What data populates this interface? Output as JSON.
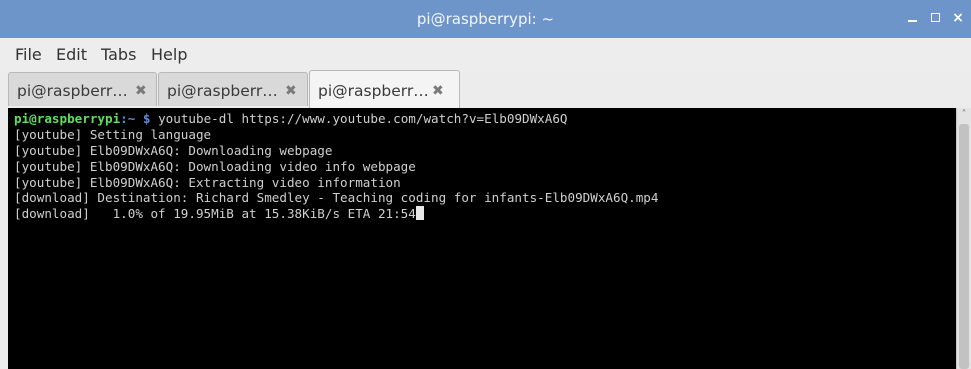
{
  "window": {
    "title": "pi@raspberrypi: ~",
    "controls": {
      "minimize": "minimize",
      "maximize": "maximize",
      "close": "×"
    }
  },
  "menu": [
    "File",
    "Edit",
    "Tabs",
    "Help"
  ],
  "tabs": [
    {
      "label": "pi@raspberr…",
      "close": "✖",
      "active": false
    },
    {
      "label": "pi@raspberr…",
      "close": "✖",
      "active": false
    },
    {
      "label": "pi@raspberr…",
      "close": "✖",
      "active": true
    }
  ],
  "terminal": {
    "prompt_user": "pi@raspberrypi",
    "prompt_path": ":~ $",
    "command": " youtube-dl https://www.youtube.com/watch?v=Elb09DWxA6Q",
    "output": [
      "[youtube] Setting language",
      "[youtube] Elb09DWxA6Q: Downloading webpage",
      "[youtube] Elb09DWxA6Q: Downloading video info webpage",
      "[youtube] Elb09DWxA6Q: Extracting video information",
      "[download] Destination: Richard Smedley - Teaching coding for infants-Elb09DWxA6Q.mp4",
      "[download]   1.0% of 19.95MiB at 15.38KiB/s ETA 21:54"
    ],
    "colors": {
      "background": "#000000",
      "text": "#cfcfcf",
      "prompt_user": "#5ce05c",
      "prompt_path": "#5c8ce0"
    }
  },
  "scrollbar": {
    "up_arrow": "˄"
  },
  "colors": {
    "titlebar": "#6d95c9",
    "chrome": "#ececec"
  }
}
